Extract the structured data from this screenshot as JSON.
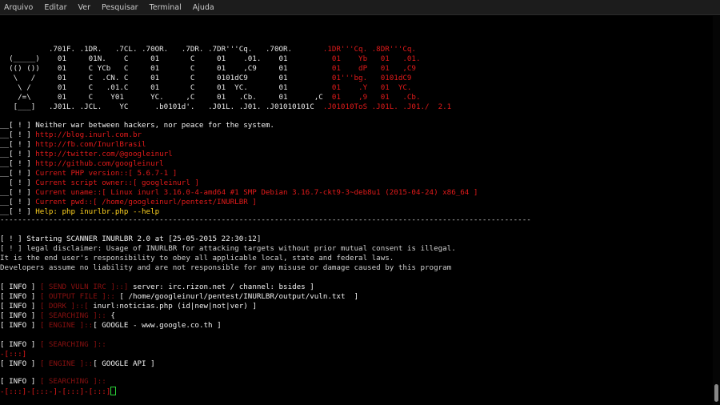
{
  "menu": [
    "Arquivo",
    "Editar",
    "Ver",
    "Pesquisar",
    "Terminal",
    "Ajuda"
  ],
  "banner": {
    "logo_lines": [
      "           .701F. .1DR.   .7CL. .70OR.   .7DR. .7DR'''Cq.   .70OR.",
      "  (_____)    01     01N.    C     01       C     01    .01.    01",
      "  (() ())    01     C YCb   C     01       C     01    ,C9     01",
      "   \\   /     01     C  .CN. C     01       C     0101dC9       01",
      "    \\ /      01     C   .01.C     01       C     01  YC.       01",
      "    /=\\      01     C    Y01      YC.     ,C     01   .Cb.     01      ,C",
      "   [___]   .J01L. .JCL.    YC      .b0101d'.   .J01L. .J01. .J01010101C"
    ],
    "logo_red_lines": [
      "                                                                         .1DR'''Cq. .8DR'''Cq.",
      "                                                                           01    Yb   01   .01.",
      "                                                                           01    dP   01   ,C9",
      "                                                                           01'''bg.   0101dC9",
      "                                                                           01    .Y   01  YC.",
      "                                                                           01    ,9   01   .Cb.",
      "                                                                         .J01010ToS .J01L. .J01./  2.1"
    ],
    "version": "2.1"
  },
  "info_lines": [
    {
      "prefix": "__[ ! ] ",
      "text": "Neither war between hackers, nor peace for the system.",
      "cls": "white"
    },
    {
      "prefix": "__[ ! ] ",
      "text": "http://blog.inurl.com.br",
      "cls": "red"
    },
    {
      "prefix": "__[ ! ] ",
      "text": "http://fb.com/InurlBrasil",
      "cls": "red"
    },
    {
      "prefix": "__[ ! ] ",
      "text": "http://twitter.com/@googleinurl",
      "cls": "red"
    },
    {
      "prefix": "__[ ! ] ",
      "text": "http://github.com/googleinurl",
      "cls": "red"
    },
    {
      "prefix": "__[ ! ] ",
      "text": "Current PHP version::[ 5.6.7-1 ]",
      "cls": "red"
    },
    {
      "prefix": "  [ ! ] ",
      "text": "Current script owner::[ googleinurl ]",
      "cls": "red"
    },
    {
      "prefix": "__[ ! ] ",
      "text": "Current uname::[ Linux inurl 3.16.0-4-amd64 #1 SMP Debian 3.16.7-ckt9-3~deb8u1 (2015-04-24) x86_64 ]",
      "cls": "red"
    },
    {
      "prefix": "__[ ! ] ",
      "text": "Current pwd::[ /home/googleinurl/pentest/INURLBR ]",
      "cls": "red"
    },
    {
      "prefix": "__[ ! ] ",
      "text": "Help: php inurlbr.php --help",
      "cls": "yellow"
    }
  ],
  "separator": "------------------------------------------------------------------------------------------------------------------------",
  "scan": {
    "start": "[ ! ] Starting SCANNER INURLBR 2.0 at [25-05-2015 22:30:12]",
    "disclaimer": [
      "[ ! ] legal disclaimer: Usage of INURLBR for attacking targets without prior mutual consent is illegal.",
      "It is the end user's responsibility to obey all applicable local, state and federal laws.",
      "Developers assume no liability and are not responsible for any misuse or damage caused by this program"
    ]
  },
  "log": [
    {
      "tag": "[ INFO ]",
      "key": "[ SEND VULN IRC ]::]",
      "val": " server: irc.rizon.net / channel: bsides ]"
    },
    {
      "tag": "[ INFO ]",
      "key": "[ OUTPUT FILE ]::",
      "val": " [ /home/googleinurl/pentest/INURLBR/output/vuln.txt  ]"
    },
    {
      "tag": "[ INFO ]",
      "key": "[ DORK ]::[",
      "val": " inurl:noticias.php (id|new|not|ver) ]"
    },
    {
      "tag": "[ INFO ]",
      "key": "[ SEARCHING ]::",
      "val": " {"
    },
    {
      "tag": "[ INFO ]",
      "key": "[ ENGINE ]::",
      "val": "[ GOOGLE - www.google.co.th ]"
    },
    {
      "tag": "",
      "key": "",
      "val": ""
    },
    {
      "tag": "[ INFO ]",
      "key": "[ SEARCHING ]::",
      "val": ""
    },
    {
      "tag": "-[:::]",
      "key": "",
      "val": ""
    },
    {
      "tag": "[ INFO ]",
      "key": "[ ENGINE ]::",
      "val": "[ GOOGLE API ]"
    },
    {
      "tag": "",
      "key": "",
      "val": ""
    },
    {
      "tag": "[ INFO ]",
      "key": "[ SEARCHING ]::",
      "val": ""
    }
  ],
  "prompt": "-[:::]-[:::-]-[:::]-[:::]"
}
